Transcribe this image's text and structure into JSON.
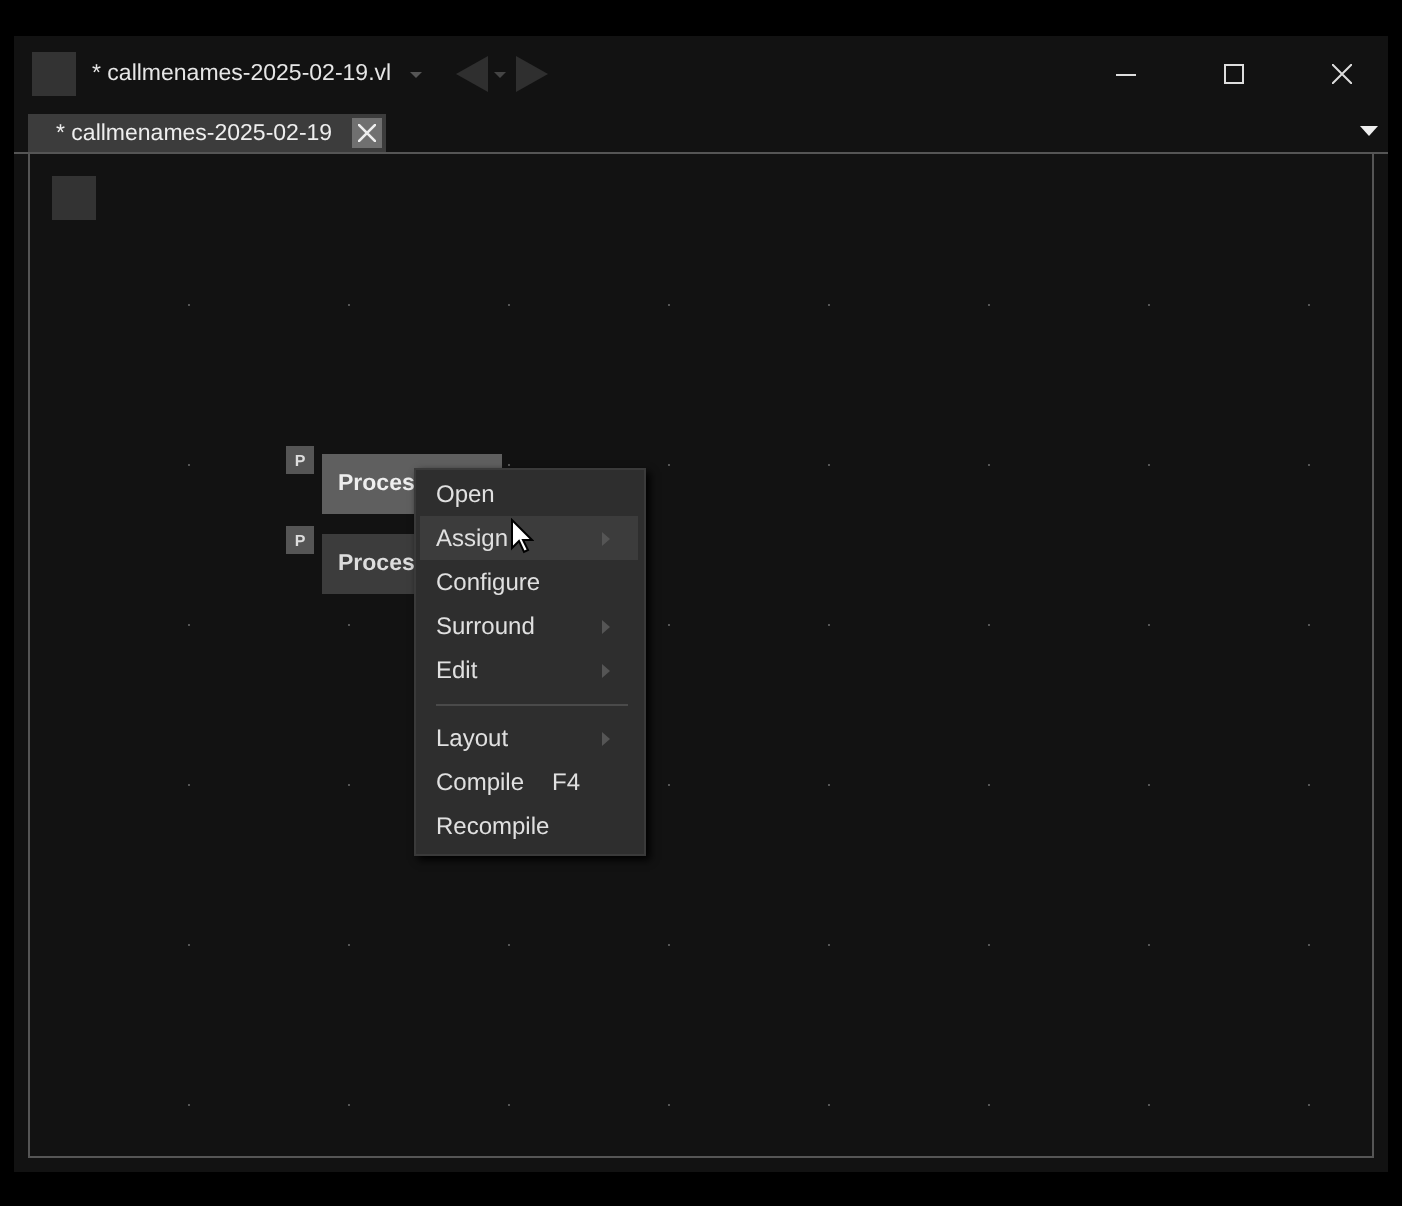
{
  "window": {
    "title": "* callmenames-2025-02-19.vl"
  },
  "tabs": [
    {
      "label": "* callmenames-2025-02-19",
      "selected": true
    }
  ],
  "nodes": [
    {
      "pin": "P",
      "label": "Proces",
      "selected": true
    },
    {
      "pin": "P",
      "label": "Proces",
      "selected": false
    }
  ],
  "context_menu": {
    "items": [
      {
        "kind": "item",
        "label": "Open",
        "selected": false,
        "submenu": false
      },
      {
        "kind": "item",
        "label": "Assign",
        "selected": true,
        "submenu": true
      },
      {
        "kind": "item",
        "label": "Configure",
        "selected": false,
        "submenu": false
      },
      {
        "kind": "item",
        "label": "Surround",
        "selected": false,
        "submenu": true
      },
      {
        "kind": "item",
        "label": "Edit",
        "selected": false,
        "submenu": true
      },
      {
        "kind": "separator"
      },
      {
        "kind": "item",
        "label": "Layout",
        "selected": false,
        "submenu": true
      },
      {
        "kind": "item",
        "label": "Compile",
        "shortcut": "F4",
        "selected": false,
        "submenu": false
      },
      {
        "kind": "item",
        "label": "Recompile",
        "selected": false,
        "submenu": false
      }
    ]
  }
}
